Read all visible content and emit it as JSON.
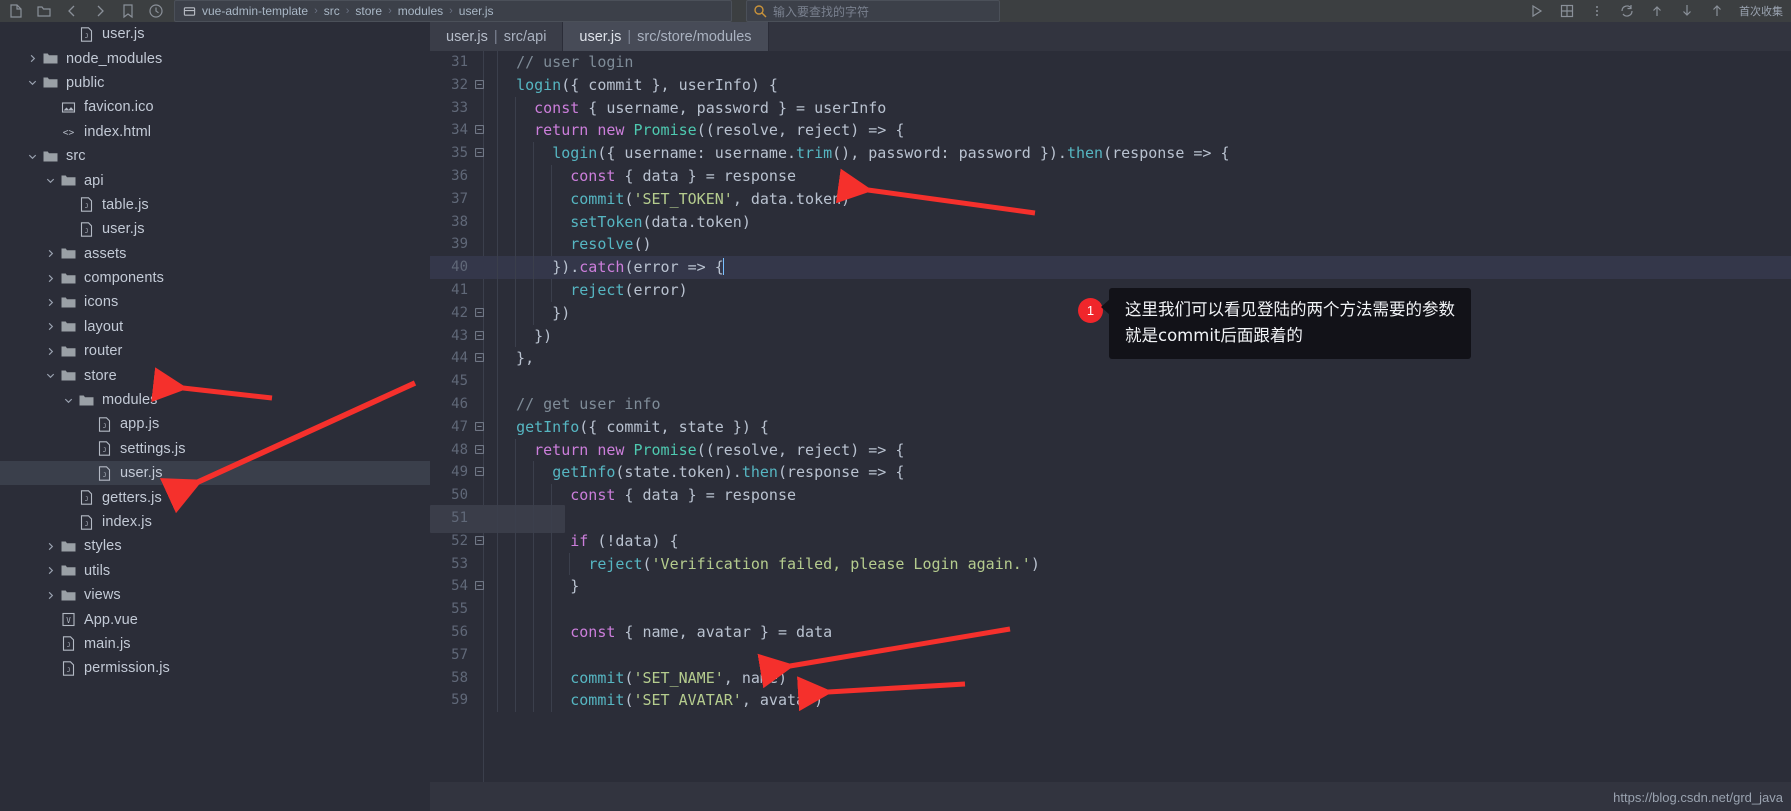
{
  "toolbar": {
    "icons": [
      "new-file-icon",
      "open-folder-icon",
      "back-arrow-icon",
      "forward-arrow-icon",
      "bookmark-icon",
      "history-icon"
    ],
    "breadcrumb": {
      "project_icon": "module-icon",
      "parts": [
        "vue-admin-template",
        "src",
        "store",
        "modules",
        "user.js"
      ],
      "separator": "›"
    },
    "search": {
      "icon": "search-icon",
      "placeholder": "输入要查找的字符"
    },
    "right_items": [
      "run-config-icon",
      "build-icon",
      "more-icon",
      "vcs-update-icon",
      "commit-icon",
      "push-icon",
      "pull-icon",
      "settings-icon"
    ],
    "right_label": "首次收集"
  },
  "tree": {
    "items": [
      {
        "label": "user.js",
        "indent": 3,
        "twisty": "none",
        "icon": "js-file-icon",
        "selected": false
      },
      {
        "label": "node_modules",
        "indent": 1,
        "twisty": "collapsed",
        "icon": "folder-icon",
        "selected": false
      },
      {
        "label": "public",
        "indent": 1,
        "twisty": "expanded",
        "icon": "folder-open-icon",
        "selected": false
      },
      {
        "label": "favicon.ico",
        "indent": 2,
        "twisty": "none",
        "icon": "image-file-icon",
        "selected": false
      },
      {
        "label": "index.html",
        "indent": 2,
        "twisty": "none",
        "icon": "html-file-icon",
        "selected": false
      },
      {
        "label": "src",
        "indent": 1,
        "twisty": "expanded",
        "icon": "folder-open-icon",
        "selected": false
      },
      {
        "label": "api",
        "indent": 2,
        "twisty": "expanded",
        "icon": "folder-open-icon",
        "selected": false
      },
      {
        "label": "table.js",
        "indent": 3,
        "twisty": "none",
        "icon": "js-file-icon",
        "selected": false
      },
      {
        "label": "user.js",
        "indent": 3,
        "twisty": "none",
        "icon": "js-file-icon",
        "selected": false
      },
      {
        "label": "assets",
        "indent": 2,
        "twisty": "collapsed",
        "icon": "folder-icon",
        "selected": false
      },
      {
        "label": "components",
        "indent": 2,
        "twisty": "collapsed",
        "icon": "folder-icon",
        "selected": false
      },
      {
        "label": "icons",
        "indent": 2,
        "twisty": "collapsed",
        "icon": "folder-icon",
        "selected": false
      },
      {
        "label": "layout",
        "indent": 2,
        "twisty": "collapsed",
        "icon": "folder-icon",
        "selected": false
      },
      {
        "label": "router",
        "indent": 2,
        "twisty": "collapsed",
        "icon": "folder-icon",
        "selected": false
      },
      {
        "label": "store",
        "indent": 2,
        "twisty": "expanded",
        "icon": "folder-open-icon",
        "selected": false
      },
      {
        "label": "modules",
        "indent": 3,
        "twisty": "expanded",
        "icon": "folder-open-icon",
        "selected": false
      },
      {
        "label": "app.js",
        "indent": 4,
        "twisty": "none",
        "icon": "js-file-icon",
        "selected": false
      },
      {
        "label": "settings.js",
        "indent": 4,
        "twisty": "none",
        "icon": "js-file-icon",
        "selected": false
      },
      {
        "label": "user.js",
        "indent": 4,
        "twisty": "none",
        "icon": "js-file-icon",
        "selected": true
      },
      {
        "label": "getters.js",
        "indent": 3,
        "twisty": "none",
        "icon": "js-file-icon",
        "selected": false
      },
      {
        "label": "index.js",
        "indent": 3,
        "twisty": "none",
        "icon": "js-file-icon",
        "selected": false
      },
      {
        "label": "styles",
        "indent": 2,
        "twisty": "collapsed",
        "icon": "folder-icon",
        "selected": false
      },
      {
        "label": "utils",
        "indent": 2,
        "twisty": "collapsed",
        "icon": "folder-icon",
        "selected": false
      },
      {
        "label": "views",
        "indent": 2,
        "twisty": "collapsed",
        "icon": "folder-icon",
        "selected": false
      },
      {
        "label": "App.vue",
        "indent": 2,
        "twisty": "none",
        "icon": "vue-file-icon",
        "selected": false
      },
      {
        "label": "main.js",
        "indent": 2,
        "twisty": "none",
        "icon": "js-file-icon",
        "selected": false
      },
      {
        "label": "permission.js",
        "indent": 2,
        "twisty": "none",
        "icon": "js-file-icon",
        "selected": false
      }
    ]
  },
  "tabs": [
    {
      "file": "user.js",
      "sep": "|",
      "dir": "src/api",
      "active": false
    },
    {
      "file": "user.js",
      "sep": "|",
      "dir": "src/store/modules",
      "active": true
    }
  ],
  "editor": {
    "current_line": 40,
    "lines": [
      {
        "n": 31,
        "fold": "",
        "indent": 1,
        "tokens": [
          {
            "t": "  ",
            "c": "c-pl"
          },
          {
            "t": "// user login",
            "c": "c-com"
          }
        ]
      },
      {
        "n": 32,
        "fold": "-",
        "indent": 1,
        "tokens": [
          {
            "t": "  ",
            "c": "c-pl"
          },
          {
            "t": "login",
            "c": "c-fn"
          },
          {
            "t": "({ commit }, userInfo) {",
            "c": "c-pl"
          }
        ]
      },
      {
        "n": 33,
        "fold": "",
        "indent": 2,
        "tokens": [
          {
            "t": "    ",
            "c": "c-pl"
          },
          {
            "t": "const",
            "c": "c-kw"
          },
          {
            "t": " { username, password } = userInfo",
            "c": "c-pl"
          }
        ]
      },
      {
        "n": 34,
        "fold": "-",
        "indent": 2,
        "tokens": [
          {
            "t": "    ",
            "c": "c-pl"
          },
          {
            "t": "return",
            "c": "c-kw"
          },
          {
            "t": " ",
            "c": "c-pl"
          },
          {
            "t": "new",
            "c": "c-kw"
          },
          {
            "t": " ",
            "c": "c-pl"
          },
          {
            "t": "Promise",
            "c": "c-cls"
          },
          {
            "t": "((resolve, reject) => {",
            "c": "c-pl"
          }
        ]
      },
      {
        "n": 35,
        "fold": "-",
        "indent": 3,
        "tokens": [
          {
            "t": "      ",
            "c": "c-pl"
          },
          {
            "t": "login",
            "c": "c-fn"
          },
          {
            "t": "({ username: username.",
            "c": "c-pl"
          },
          {
            "t": "trim",
            "c": "c-fn"
          },
          {
            "t": "(), password: password }).",
            "c": "c-pl"
          },
          {
            "t": "then",
            "c": "c-fn"
          },
          {
            "t": "(response => {",
            "c": "c-pl"
          }
        ]
      },
      {
        "n": 36,
        "fold": "",
        "indent": 4,
        "tokens": [
          {
            "t": "        ",
            "c": "c-pl"
          },
          {
            "t": "const",
            "c": "c-kw"
          },
          {
            "t": " { data } = response",
            "c": "c-pl"
          }
        ]
      },
      {
        "n": 37,
        "fold": "",
        "indent": 4,
        "tokens": [
          {
            "t": "        ",
            "c": "c-pl"
          },
          {
            "t": "commit",
            "c": "c-fn"
          },
          {
            "t": "(",
            "c": "c-pl"
          },
          {
            "t": "'SET_TOKEN'",
            "c": "c-str"
          },
          {
            "t": ", data.token)",
            "c": "c-pl"
          }
        ]
      },
      {
        "n": 38,
        "fold": "",
        "indent": 4,
        "tokens": [
          {
            "t": "        ",
            "c": "c-pl"
          },
          {
            "t": "setToken",
            "c": "c-fn"
          },
          {
            "t": "(data.token)",
            "c": "c-pl"
          }
        ]
      },
      {
        "n": 39,
        "fold": "",
        "indent": 4,
        "tokens": [
          {
            "t": "        ",
            "c": "c-pl"
          },
          {
            "t": "resolve",
            "c": "c-fn"
          },
          {
            "t": "()",
            "c": "c-pl"
          }
        ]
      },
      {
        "n": 40,
        "fold": "",
        "indent": 3,
        "tokens": [
          {
            "t": "      ",
            "c": "c-pl"
          },
          {
            "t": "}).",
            "c": "c-pl"
          },
          {
            "t": "catch",
            "c": "c-kw"
          },
          {
            "t": "(error => {",
            "c": "c-pl"
          }
        ],
        "caret": true
      },
      {
        "n": 41,
        "fold": "",
        "indent": 4,
        "tokens": [
          {
            "t": "        ",
            "c": "c-pl"
          },
          {
            "t": "reject",
            "c": "c-fn"
          },
          {
            "t": "(error)",
            "c": "c-pl"
          }
        ]
      },
      {
        "n": 42,
        "fold": "-",
        "indent": 3,
        "tokens": [
          {
            "t": "      })",
            "c": "c-pl"
          }
        ]
      },
      {
        "n": 43,
        "fold": "-",
        "indent": 2,
        "tokens": [
          {
            "t": "    })",
            "c": "c-pl"
          }
        ]
      },
      {
        "n": 44,
        "fold": "-",
        "indent": 1,
        "tokens": [
          {
            "t": "  },",
            "c": "c-pl"
          }
        ]
      },
      {
        "n": 45,
        "fold": "",
        "indent": 1,
        "tokens": [
          {
            "t": "",
            "c": "c-pl"
          }
        ]
      },
      {
        "n": 46,
        "fold": "",
        "indent": 1,
        "tokens": [
          {
            "t": "  ",
            "c": "c-pl"
          },
          {
            "t": "// get user info",
            "c": "c-com"
          }
        ]
      },
      {
        "n": 47,
        "fold": "-",
        "indent": 1,
        "tokens": [
          {
            "t": "  ",
            "c": "c-pl"
          },
          {
            "t": "getInfo",
            "c": "c-fn"
          },
          {
            "t": "({ commit, state }) {",
            "c": "c-pl"
          }
        ]
      },
      {
        "n": 48,
        "fold": "-",
        "indent": 2,
        "tokens": [
          {
            "t": "    ",
            "c": "c-pl"
          },
          {
            "t": "return",
            "c": "c-kw"
          },
          {
            "t": " ",
            "c": "c-pl"
          },
          {
            "t": "new",
            "c": "c-kw"
          },
          {
            "t": " ",
            "c": "c-pl"
          },
          {
            "t": "Promise",
            "c": "c-cls"
          },
          {
            "t": "((resolve, reject) => {",
            "c": "c-pl"
          }
        ]
      },
      {
        "n": 49,
        "fold": "-",
        "indent": 3,
        "tokens": [
          {
            "t": "      ",
            "c": "c-pl"
          },
          {
            "t": "getInfo",
            "c": "c-fn"
          },
          {
            "t": "(state.token).",
            "c": "c-pl"
          },
          {
            "t": "then",
            "c": "c-fn"
          },
          {
            "t": "(response => {",
            "c": "c-pl"
          }
        ]
      },
      {
        "n": 50,
        "fold": "",
        "indent": 4,
        "tokens": [
          {
            "t": "        ",
            "c": "c-pl"
          },
          {
            "t": "const",
            "c": "c-kw"
          },
          {
            "t": " { data } = response",
            "c": "c-pl"
          }
        ]
      },
      {
        "n": 51,
        "fold": "",
        "indent": 4,
        "tokens": [
          {
            "t": "",
            "c": "c-pl"
          }
        ]
      },
      {
        "n": 52,
        "fold": "-",
        "indent": 4,
        "tokens": [
          {
            "t": "        ",
            "c": "c-pl"
          },
          {
            "t": "if",
            "c": "c-kw"
          },
          {
            "t": " (!data) {",
            "c": "c-pl"
          }
        ]
      },
      {
        "n": 53,
        "fold": "",
        "indent": 5,
        "tokens": [
          {
            "t": "          ",
            "c": "c-pl"
          },
          {
            "t": "reject",
            "c": "c-fn"
          },
          {
            "t": "(",
            "c": "c-pl"
          },
          {
            "t": "'Verification failed, please Login again.'",
            "c": "c-str"
          },
          {
            "t": ")",
            "c": "c-pl"
          }
        ]
      },
      {
        "n": 54,
        "fold": "-",
        "indent": 4,
        "tokens": [
          {
            "t": "        }",
            "c": "c-pl"
          }
        ]
      },
      {
        "n": 55,
        "fold": "",
        "indent": 4,
        "tokens": [
          {
            "t": "",
            "c": "c-pl"
          }
        ]
      },
      {
        "n": 56,
        "fold": "",
        "indent": 4,
        "tokens": [
          {
            "t": "        ",
            "c": "c-pl"
          },
          {
            "t": "const",
            "c": "c-kw"
          },
          {
            "t": " { name, avatar } = data",
            "c": "c-pl"
          }
        ]
      },
      {
        "n": 57,
        "fold": "",
        "indent": 4,
        "tokens": [
          {
            "t": "",
            "c": "c-pl"
          }
        ]
      },
      {
        "n": 58,
        "fold": "",
        "indent": 4,
        "tokens": [
          {
            "t": "        ",
            "c": "c-pl"
          },
          {
            "t": "commit",
            "c": "c-fn"
          },
          {
            "t": "(",
            "c": "c-pl"
          },
          {
            "t": "'SET_NAME'",
            "c": "c-str"
          },
          {
            "t": ", name)",
            "c": "c-pl"
          }
        ]
      },
      {
        "n": 59,
        "fold": "",
        "indent": 4,
        "tokens": [
          {
            "t": "        ",
            "c": "c-pl"
          },
          {
            "t": "commit",
            "c": "c-fn"
          },
          {
            "t": "(",
            "c": "c-pl"
          },
          {
            "t": "'SET AVATAR'",
            "c": "c-str"
          },
          {
            "t": ", avatar)",
            "c": "c-pl"
          }
        ]
      }
    ]
  },
  "callout": {
    "number": "1",
    "line1": "这里我们可以看见登陆的两个方法需要的参数",
    "line2": "就是commit后面跟着的"
  },
  "watermark": "https://blog.csdn.net/grd_java",
  "colors": {
    "accent_red": "#f0262b",
    "editor_bg": "#2b2d38",
    "gutter_text": "#606878",
    "string": "#b5cc8e",
    "keyword": "#cc7edb",
    "function": "#56b6c2",
    "comment": "#7f8c98",
    "selection": "#3a3f4b"
  }
}
